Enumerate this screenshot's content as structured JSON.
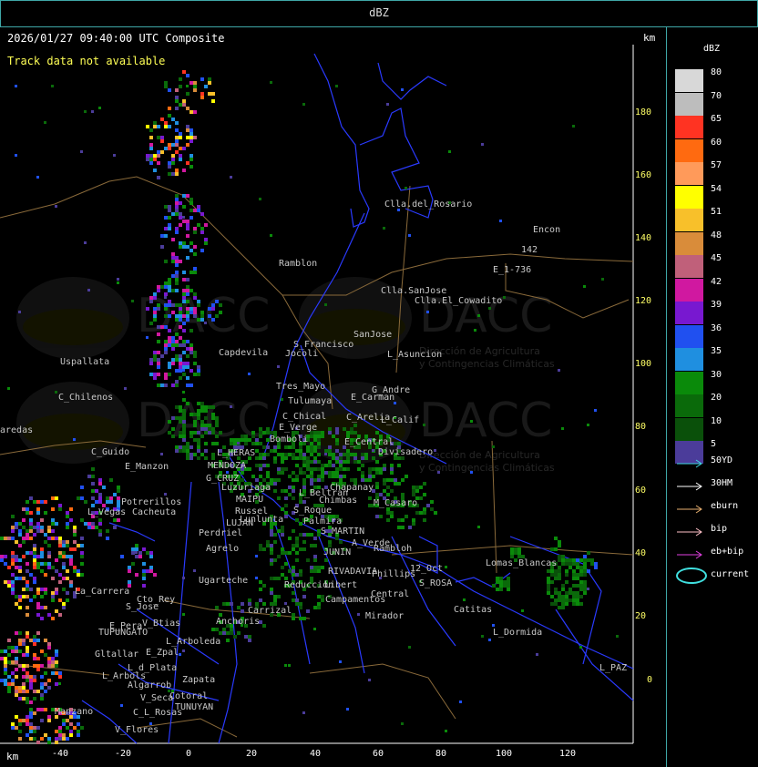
{
  "window": {
    "title": "dBZ"
  },
  "header": {
    "timestamp": "2026/01/27 09:40:00 UTC Composite",
    "track_status": "Track data not available",
    "km_label": "km"
  },
  "watermark": {
    "brand": "DACC",
    "line1": "Dirección de Agricultura",
    "line2": "y Contingencias Climáticas"
  },
  "axes": {
    "y_ticks": [
      "180",
      "160",
      "140",
      "120",
      "100",
      "80",
      "60",
      "40",
      "20",
      "0"
    ],
    "x_ticks": [
      "-40",
      "-20",
      "0",
      "20",
      "40",
      "60",
      "80",
      "100",
      "120"
    ],
    "x_unit": "km",
    "y_unit": "km"
  },
  "legend": {
    "title": "dBZ",
    "scale": [
      {
        "label": "80",
        "color": "#d8d8d8"
      },
      {
        "label": "70",
        "color": "#bdbdbd"
      },
      {
        "label": "65",
        "color": "#ff3322"
      },
      {
        "label": "60",
        "color": "#ff6a10"
      },
      {
        "label": "57",
        "color": "#ff9a5a"
      },
      {
        "label": "54",
        "color": "#ffff00"
      },
      {
        "label": "51",
        "color": "#f8c02a"
      },
      {
        "label": "48",
        "color": "#d98c3a"
      },
      {
        "label": "45",
        "color": "#c0607a"
      },
      {
        "label": "42",
        "color": "#d018a0"
      },
      {
        "label": "39",
        "color": "#7818d0"
      },
      {
        "label": "36",
        "color": "#2050f0"
      },
      {
        "label": "35",
        "color": "#1f8fe0"
      },
      {
        "label": "30",
        "color": "#0a8a0a"
      },
      {
        "label": "20",
        "color": "#0a6a0a"
      },
      {
        "label": "10",
        "color": "#0a500a"
      },
      {
        "label": "5",
        "color": "#4b3c9a"
      }
    ],
    "tracks": [
      {
        "label": "50YD",
        "color": "#40d8e0"
      },
      {
        "label": "30HM",
        "color": "#ffffff"
      },
      {
        "label": "eburn",
        "color": "#e8b070"
      },
      {
        "label": "bip",
        "color": "#ffc0c8"
      },
      {
        "label": "eb+bip",
        "color": "#e040e0"
      },
      {
        "label": "current",
        "color": "#40e0e0"
      }
    ]
  },
  "places": [
    "Clla.del_Rosario",
    "Encon",
    "Ramblon",
    "E_1-736",
    "142",
    "Clla.SanJose",
    "Clla.El_Cowadito",
    "Uspallata",
    "Capdevila",
    "S_Francisco",
    "SanJose",
    "L_Asuncion",
    "Tres_Mayo",
    "Jocoli",
    "C_Chilenos",
    "Tulumaya",
    "E_Carman",
    "G_Andre",
    "C_Arelia",
    "L_Calif",
    "C_Chical",
    "E_Verge",
    "aredas",
    "Bomboli",
    "E_Central",
    "Divisadero",
    "C_Guido",
    "L_HERAS",
    "E_Manzon",
    "MENDOZA",
    "G_CRUZ",
    "Luzuriaga",
    "L_Beltran",
    "Chapanay",
    "Chimbas",
    "M_Casaro",
    "Potrerillos",
    "L_Vegas",
    "Cacheuta",
    "MAIPU",
    "Russel",
    "LUJAN",
    "Lunlunta",
    "S_Roque",
    "Palmira",
    "S_MARTIN",
    "A_Verde",
    "Rambloh",
    "Perdriel",
    "Agrelo",
    "JUNIN",
    "Lomas_Blancas",
    "12_Oct",
    "RIVADAVIA",
    "Phillips",
    "Ugarteche",
    "Libert",
    "Campamentos",
    "Central",
    "S_ROSA",
    "Catitas",
    "La_Carrera",
    "Cto_Rey",
    "S_Jose",
    "Carrizal",
    "Reducción",
    "E_Pera",
    "V_Btias",
    "Anchoris",
    "TUPUNGATO",
    "L_Arboleda",
    "Mirador",
    "L_Dormida",
    "Gltallar",
    "E_Zpal",
    "L_d_Plata",
    "L_Arbols",
    "Zapata",
    "L_PAZ",
    "Algarrob",
    "V_Seca",
    "Cotoral",
    "TUNUYAN",
    "Manzano",
    "C_L_Rosas",
    "V_Flores"
  ]
}
